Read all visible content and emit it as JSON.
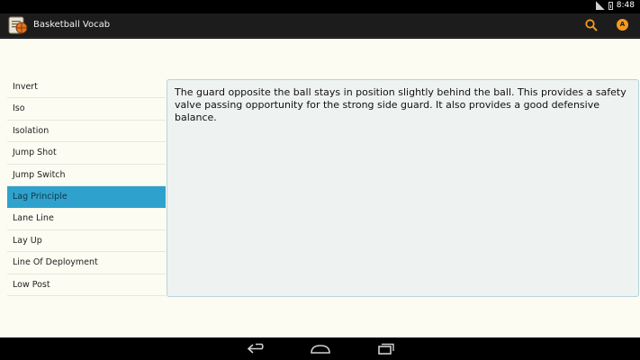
{
  "status_bar": {
    "time": "8:48"
  },
  "app": {
    "title": "Basketball Vocab"
  },
  "action_bar": {
    "orange_button_letter": "A"
  },
  "colors": {
    "accent": "#2ea2cc",
    "orange": "#f39a1f",
    "action_bar": "#1c1c1c",
    "background": "#fcfcf2"
  },
  "icons": {
    "search": "search-icon",
    "app": "basketball-app-icon",
    "back": "back-icon",
    "home": "home-icon",
    "recent": "recent-apps-icon"
  },
  "word_list": {
    "selected_index": 5,
    "items": [
      {
        "label": "Invert"
      },
      {
        "label": "Iso"
      },
      {
        "label": "Isolation"
      },
      {
        "label": "Jump Shot"
      },
      {
        "label": "Jump Switch"
      },
      {
        "label": "Lag Principle"
      },
      {
        "label": "Lane Line"
      },
      {
        "label": "Lay Up"
      },
      {
        "label": "Line Of Deployment"
      },
      {
        "label": "Low Post"
      }
    ]
  },
  "definition": {
    "text": "The guard opposite the ball stays in position slightly behind the ball. This provides a safety valve passing opportunity for the strong side guard. It also provides a good defensive balance."
  }
}
